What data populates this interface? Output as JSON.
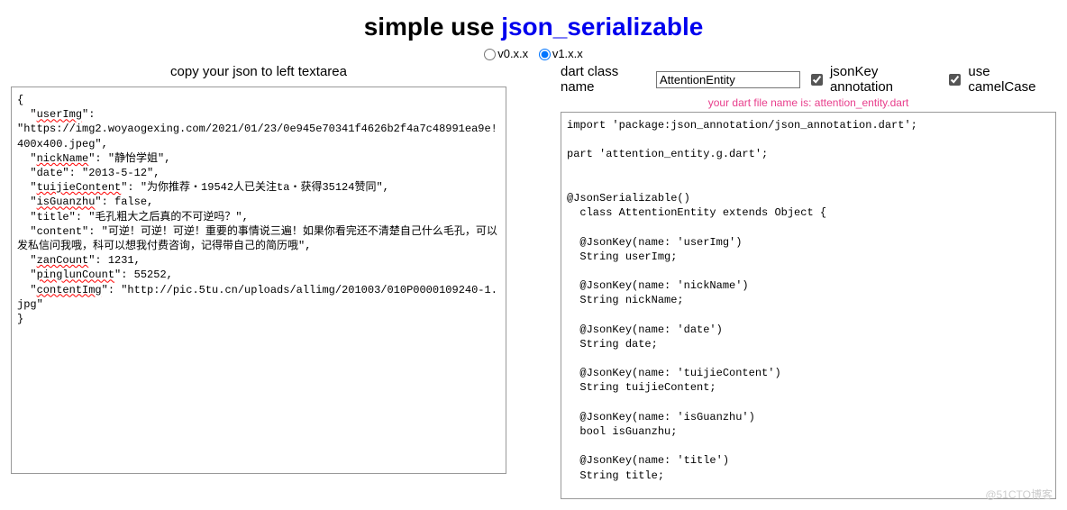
{
  "title_prefix": "simple use ",
  "title_link": "json_serializable",
  "radio": {
    "opt0": "v0.x.x",
    "opt1": "v1.x.x",
    "selected": "v1.x.x"
  },
  "left": {
    "header": "copy your json to left textarea",
    "json_plain": "{\n  \"userImg\":\n\"https://img2.woyaogexing.com/2021/01/23/0e945e70341f4626b2f4a7c48991ea9e!400x400.jpeg\",\n  \"nickName\": \"静怡学姐\",\n  \"date\": \"2013-5-12\",\n  \"tuijieContent\": \"为你推荐・19542人已关注ta・获得35124赞同\",\n  \"isGuanzhu\": false,\n  \"title\": \"毛孔粗大之后真的不可逆吗？\",\n  \"content\": \"可逆！可逆！可逆！重要的事情说三遍！如果你看完还不清楚自己什么毛孔，可以发私信问我哦，科可以想我付费咨询，记得带自己的简历哦\",\n  \"zanCount\": 1231,\n  \"pinglunCount\": 55252,\n  \"contentImg\": \"http://pic.5tu.cn/uploads/allimg/201003/010P0000109240-1.jpg\"\n}",
    "keys_underlined": [
      "userImg",
      "nickName",
      "tuijieContent",
      "isGuanzhu",
      "zanCount",
      "pinglunCount",
      "contentImg"
    ]
  },
  "right": {
    "class_label": "dart class name",
    "class_value": "AttentionEntity",
    "jsonkey_label": "jsonKey annotation",
    "jsonkey_checked": true,
    "camel_label": "use camelCase",
    "camel_checked": true,
    "filename_hint": "your dart file name is: attention_entity.dart",
    "code": "import 'package:json_annotation/json_annotation.dart';\n\npart 'attention_entity.g.dart';\n\n\n@JsonSerializable()\n  class AttentionEntity extends Object {\n\n  @JsonKey(name: 'userImg')\n  String userImg;\n\n  @JsonKey(name: 'nickName')\n  String nickName;\n\n  @JsonKey(name: 'date')\n  String date;\n\n  @JsonKey(name: 'tuijieContent')\n  String tuijieContent;\n\n  @JsonKey(name: 'isGuanzhu')\n  bool isGuanzhu;\n\n  @JsonKey(name: 'title')\n  String title;\n\n  @JsonKey(name: 'content')\n  String content;\n\n  @JsonKey(name: 'zanCount')\n  int zanCount;"
  },
  "watermark": "@51CTO博客"
}
